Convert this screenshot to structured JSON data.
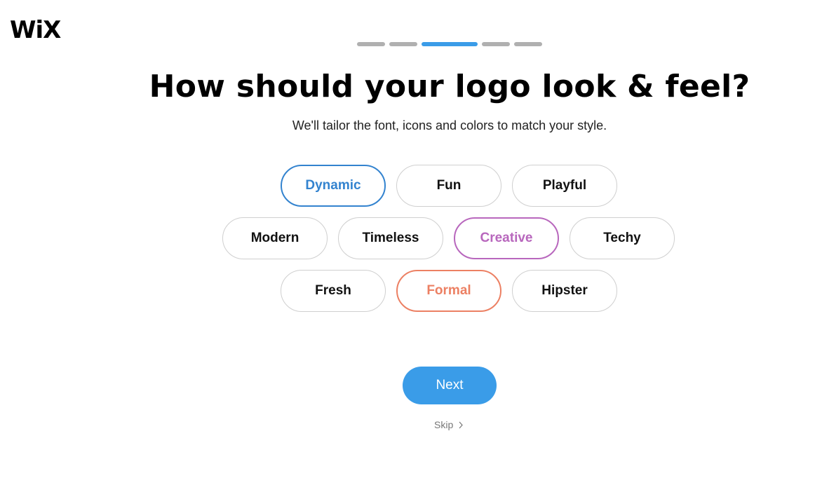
{
  "brand": {
    "logo": "WiX"
  },
  "progress": {
    "steps": 5,
    "current": 3
  },
  "header": {
    "title": "How should your logo look & feel?",
    "subtitle": "We'll tailor the font, icons and colors to match your style."
  },
  "options": [
    {
      "label": "Dynamic",
      "selected": true,
      "color": "#3383cf"
    },
    {
      "label": "Fun",
      "selected": false
    },
    {
      "label": "Playful",
      "selected": false
    },
    {
      "label": "Modern",
      "selected": false
    },
    {
      "label": "Timeless",
      "selected": false
    },
    {
      "label": "Creative",
      "selected": true,
      "color": "#b867bd"
    },
    {
      "label": "Techy",
      "selected": false
    },
    {
      "label": "Fresh",
      "selected": false
    },
    {
      "label": "Formal",
      "selected": true,
      "color": "#ec8063"
    },
    {
      "label": "Hipster",
      "selected": false
    }
  ],
  "actions": {
    "next_label": "Next",
    "skip_label": "Skip",
    "skip_icon": "chevron-right-icon"
  }
}
